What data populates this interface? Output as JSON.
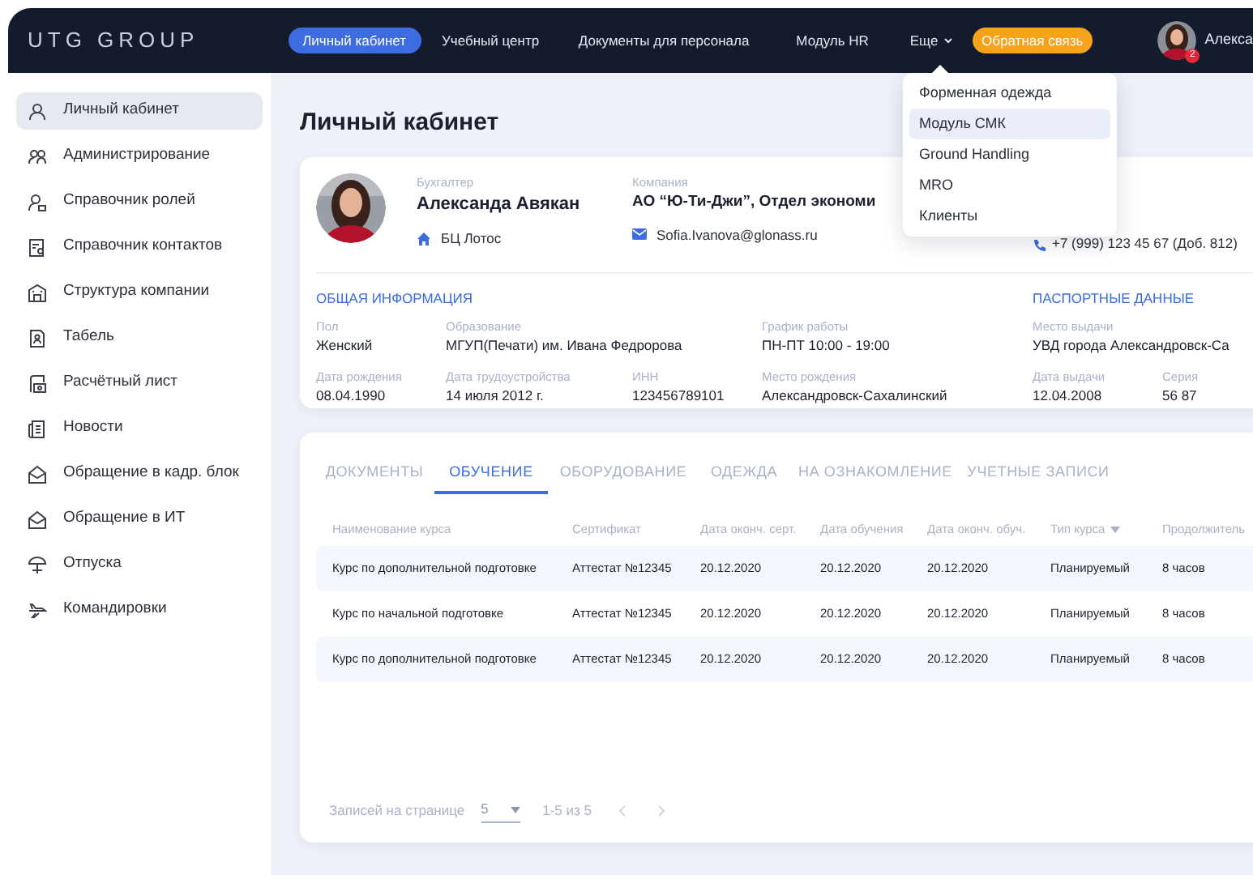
{
  "header": {
    "logo": "UTG GROUP",
    "nav": [
      {
        "label": "Личный кабинет",
        "selected": true,
        "kind": "link"
      },
      {
        "label": "Учебный центр",
        "selected": false,
        "kind": "link"
      },
      {
        "label": "Документы для персонала",
        "selected": false,
        "kind": "link"
      },
      {
        "label": "Модуль HR",
        "selected": false,
        "kind": "link"
      },
      {
        "label": "Еще",
        "selected": false,
        "kind": "menu"
      }
    ],
    "feedback_button": "Обратная связь",
    "user_name": "Алекса",
    "notification_count": "2"
  },
  "more_menu": {
    "items": [
      {
        "label": "Форменная одежда",
        "selected": false
      },
      {
        "label": "Модуль СМК",
        "selected": true
      },
      {
        "label": "Ground Handling",
        "selected": false
      },
      {
        "label": "MRO",
        "selected": false
      },
      {
        "label": "Клиенты",
        "selected": false
      }
    ]
  },
  "sidebar": {
    "items": [
      {
        "label": "Личный кабинет",
        "selected": true
      },
      {
        "label": "Администрирование",
        "selected": false
      },
      {
        "label": "Справочник ролей",
        "selected": false
      },
      {
        "label": "Справочник контактов",
        "selected": false
      },
      {
        "label": "Структура компании",
        "selected": false
      },
      {
        "label": "Табель",
        "selected": false
      },
      {
        "label": "Расчётный лист",
        "selected": false
      },
      {
        "label": "Новости",
        "selected": false
      },
      {
        "label": "Обращение в кадр. блок",
        "selected": false
      },
      {
        "label": "Обращение в ИТ",
        "selected": false
      },
      {
        "label": "Отпуска",
        "selected": false
      },
      {
        "label": "Командировки",
        "selected": false
      }
    ]
  },
  "page_title": "Личный кабинет",
  "profile": {
    "position": "Бухгалтер",
    "name": "Александа Авякан",
    "company_label": "Компания",
    "company": "АО “Ю-Ти-Джи”, Отдел экономи",
    "office": "БЦ Лотос",
    "email": "Sofia.Ivanova@glonass.ru",
    "phone": "+7 (999) 123 45 67 (Доб. 812)"
  },
  "general_info": {
    "title": "ОБЩАЯ ИНФОРМАЦИЯ",
    "rows": [
      [
        {
          "label": "Пол",
          "value": "Женский"
        },
        {
          "label": "Образование",
          "value": "МГУП(Печати) им. Ивана Федророва"
        },
        null,
        {
          "label": "График работы",
          "value": "ПН-ПТ 10:00 - 19:00"
        }
      ],
      [
        {
          "label": "Дата рождения",
          "value": "08.04.1990"
        },
        {
          "label": "Дата трудоустройства",
          "value": "14 июля 2012 г."
        },
        {
          "label": "ИНН",
          "value": "123456789101"
        },
        {
          "label": "Место рождения",
          "value": "Александровск-Сахалинский"
        }
      ]
    ]
  },
  "passport": {
    "title": "ПАСПОРТНЫЕ ДАННЫЕ",
    "rows": [
      [
        {
          "label": "Место выдачи",
          "value": "УВД города  Александровск-Са"
        }
      ],
      [
        {
          "label": "Дата выдачи",
          "value": "12.04.2008"
        },
        {
          "label": "Серия",
          "value": "56 87"
        }
      ]
    ]
  },
  "records": {
    "tabs": [
      {
        "label": "ДОКУМЕНТЫ",
        "selected": false
      },
      {
        "label": "ОБУЧЕНИЕ",
        "selected": true
      },
      {
        "label": "ОБОРУДОВАНИЕ",
        "selected": false
      },
      {
        "label": "ОДЕЖДА",
        "selected": false
      },
      {
        "label": "НА ОЗНАКОМЛЕНИЕ",
        "selected": false
      },
      {
        "label": "УЧЕТНЫЕ ЗАПИСИ",
        "selected": false
      }
    ],
    "columns": [
      {
        "label": "Наименование курса",
        "sorted": false
      },
      {
        "label": "Сертификат",
        "sorted": false
      },
      {
        "label": "Дата оконч. серт.",
        "sorted": false
      },
      {
        "label": "Дата обучения",
        "sorted": false
      },
      {
        "label": "Дата оконч. обуч.",
        "sorted": false
      },
      {
        "label": "Тип курса",
        "sorted": true
      },
      {
        "label": "Продолжитель",
        "sorted": false
      }
    ],
    "rows": [
      [
        "Курс по дополнительной подготовке",
        "Аттестат №12345",
        "20.12.2020",
        "20.12.2020",
        "20.12.2020",
        "Планируемый",
        "8 часов"
      ],
      [
        "Курс по начальной подготовке",
        "Аттестат №12345",
        "20.12.2020",
        "20.12.2020",
        "20.12.2020",
        "Планируемый",
        "8 часов"
      ],
      [
        "Курс по дополнительной подготовке",
        "Аттестат №12345",
        "20.12.2020",
        "20.12.2020",
        "20.12.2020",
        "Планируемый",
        "8 часов"
      ]
    ],
    "pagination": {
      "label": "Записей на странице",
      "page_size": "5",
      "range": "1-5 из 5"
    }
  }
}
